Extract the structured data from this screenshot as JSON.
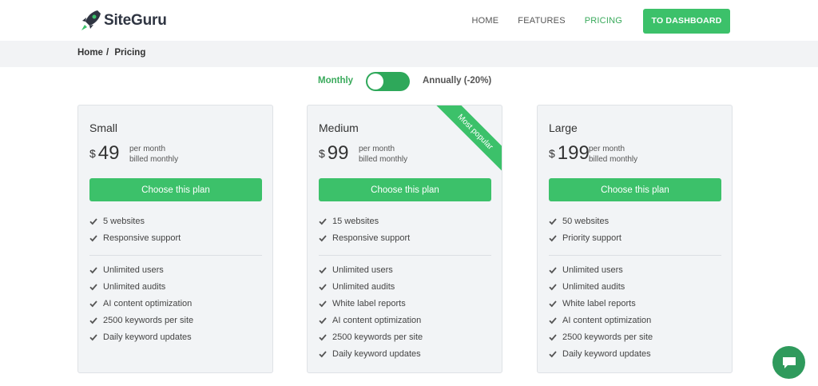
{
  "brand": {
    "name": "SiteGuru"
  },
  "nav": {
    "home": "HOME",
    "features": "FEATURES",
    "pricing": "PRICING",
    "dashboard": "TO DASHBOARD"
  },
  "breadcrumb": {
    "home": "Home",
    "sep": "/",
    "current": "Pricing"
  },
  "billing": {
    "monthly": "Monthly",
    "annually": "Annually (-20%)",
    "selected": "Monthly"
  },
  "plans": [
    {
      "name": "Small",
      "currency": "$",
      "amount": "49",
      "note1": "per month",
      "note2": "billed monthly",
      "cta": "Choose this plan",
      "top_features": [
        "5 websites",
        "Responsive support"
      ],
      "features": [
        "Unlimited users",
        "Unlimited audits",
        "AI content optimization",
        "2500 keywords per site",
        "Daily keyword updates"
      ]
    },
    {
      "name": "Medium",
      "currency": "$",
      "amount": "99",
      "note1": "per month",
      "note2": "billed monthly",
      "cta": "Choose this plan",
      "ribbon": "Most popular",
      "top_features": [
        "15 websites",
        "Responsive support"
      ],
      "features": [
        "Unlimited users",
        "Unlimited audits",
        "White label reports",
        "AI content optimization",
        "2500 keywords per site",
        "Daily keyword updates"
      ]
    },
    {
      "name": "Large",
      "currency": "$",
      "amount": "199",
      "note1": "per month",
      "note2": "billed monthly",
      "cta": "Choose this plan",
      "top_features": [
        "50 websites",
        "Priority support"
      ],
      "features": [
        "Unlimited users",
        "Unlimited audits",
        "White label reports",
        "AI content optimization",
        "2500 keywords per site",
        "Daily keyword updates"
      ]
    }
  ],
  "colors": {
    "accent": "#3cc16a",
    "accent_text": "#3aaa5c",
    "card_bg": "#f2f4f6"
  },
  "icons": {
    "logo": "rocket-icon",
    "check": "check-icon",
    "chat": "chat-bubble-icon"
  }
}
